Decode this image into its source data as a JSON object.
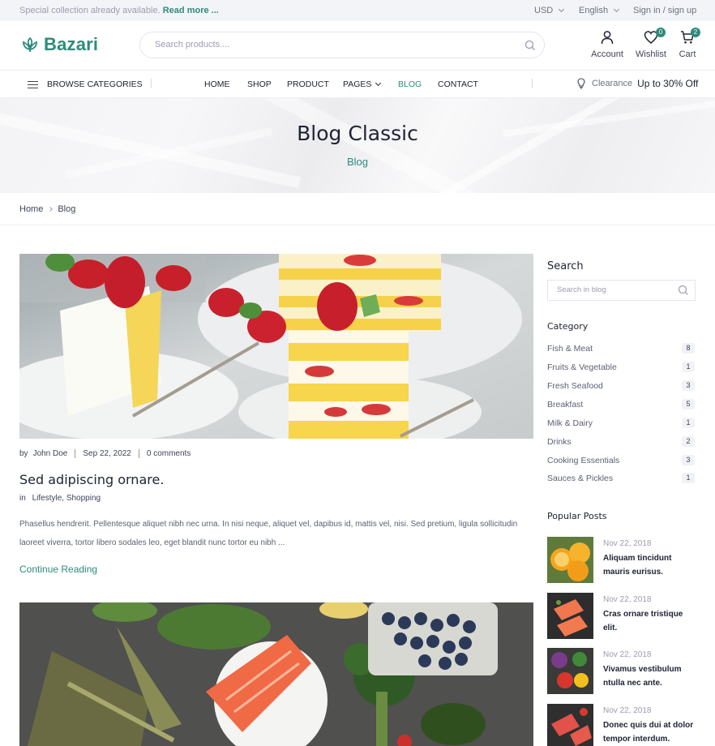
{
  "topbar": {
    "promo_text": "Special collection already available.",
    "promo_link": "Read more ...",
    "currency": "USD",
    "language": "English",
    "account_link": "Sign in / sign up"
  },
  "header": {
    "logo_text": "Bazari",
    "search_placeholder": "Search products....",
    "account_label": "Account",
    "wishlist_label": "Wishlist",
    "wishlist_count": "0",
    "cart_label": "Cart",
    "cart_count": "2"
  },
  "nav": {
    "browse_label": "BROWSE CATEGORIES",
    "items": [
      {
        "label": "HOME"
      },
      {
        "label": "SHOP"
      },
      {
        "label": "PRODUCT"
      },
      {
        "label": "PAGES"
      },
      {
        "label": "BLOG"
      },
      {
        "label": "CONTACT"
      }
    ],
    "active": "BLOG",
    "clearance_label": "Clearance",
    "clearance_offer": "Up to 30% Off"
  },
  "hero": {
    "title": "Blog Classic",
    "subtitle": "Blog"
  },
  "breadcrumb": [
    "Home",
    "Blog"
  ],
  "post": {
    "author_prefix": "by",
    "author": "John Doe",
    "date": "Sep 22, 2022",
    "comments": "0 comments",
    "title": "Sed adipiscing ornare.",
    "categories_prefix": "in",
    "categories": [
      "Lifestyle,",
      "Shopping"
    ],
    "excerpt": "Phasellus hendrerit. Pellentesque aliquet nibh nec urna. In nisi neque, aliquet vel, dapibus id, mattis vel, nisi. Sed pretium, ligula sollicitudin laoreet viverra, tortor libero sodales leo, eget blandit nunc tortor eu nibh ...",
    "read_more": "Continue Reading"
  },
  "sidebar": {
    "search_title": "Search",
    "search_placeholder": "Search in blog",
    "category_title": "Category",
    "categories": [
      {
        "name": "Fish & Meat",
        "count": "8"
      },
      {
        "name": "Fruits & Vegetable",
        "count": "1"
      },
      {
        "name": "Fresh Seafood",
        "count": "3"
      },
      {
        "name": "Breakfast",
        "count": "5"
      },
      {
        "name": "Milk & Dairy",
        "count": "1"
      },
      {
        "name": "Drinks",
        "count": "2"
      },
      {
        "name": "Cooking Essentials",
        "count": "3"
      },
      {
        "name": "Sauces & Pickles",
        "count": "1"
      }
    ],
    "popular_title": "Popular Posts",
    "popular": [
      {
        "date": "Nov 22, 2018",
        "title": "Aliquam tincidunt mauris eurisus."
      },
      {
        "date": "Nov 22, 2018",
        "title": "Cras ornare tristique elit."
      },
      {
        "date": "Nov 22, 2018",
        "title": "Vivamus vestibulum ntulla nec ante."
      },
      {
        "date": "Nov 22, 2018",
        "title": "Donec quis dui at dolor tempor interdum."
      }
    ]
  },
  "colors": {
    "accent": "#2e8b7b",
    "text": "#202435",
    "muted": "#9b9bb4"
  }
}
